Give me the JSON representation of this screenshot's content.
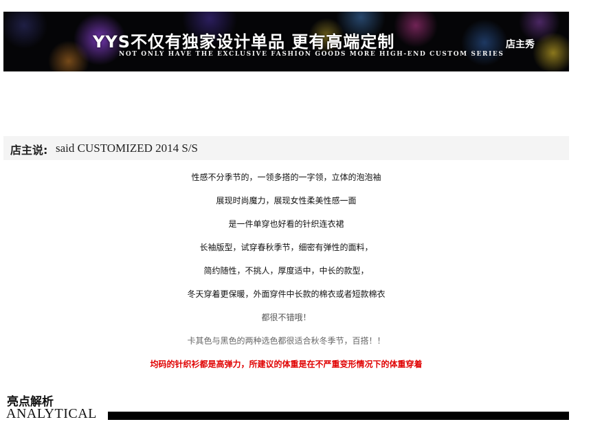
{
  "banner": {
    "title": "YYS不仅有独家设计单品  更有高端定制",
    "subtitle": "NOT ONLY HAVE THE EXCLUSIVE FASHION GOODS MORE HIGH-END CUSTOM SERIES",
    "tag": "店主秀"
  },
  "owner_says": {
    "label": "店主说:",
    "text": "said CUSTOMIZED 2014 S/S"
  },
  "description": {
    "lines": [
      "性感不分季节的，一领多搭的一字领，立体的泡泡袖",
      "展现时尚魔力，展现女性柔美性感一面",
      "是一件单穿也好看的针织连衣裙",
      "长袖版型，试穿春秋季节，细密有弹性的面料，",
      "简约随性，不挑人，厚度适中，中长的款型，",
      "冬天穿着更保暖，外面穿件中长款的棉衣或者短款棉衣",
      "都很不错哦！",
      "卡其色与黑色的两种选色都很适合秋冬季节，百搭！！",
      "均码的针织衫都是高弹力，所建议的体重是在不严重变形情况下的体重穿着"
    ],
    "highlight_color": "#e00000"
  },
  "analytical": {
    "title_cn": "亮点解析",
    "title_en": "ANALYTICAL"
  }
}
